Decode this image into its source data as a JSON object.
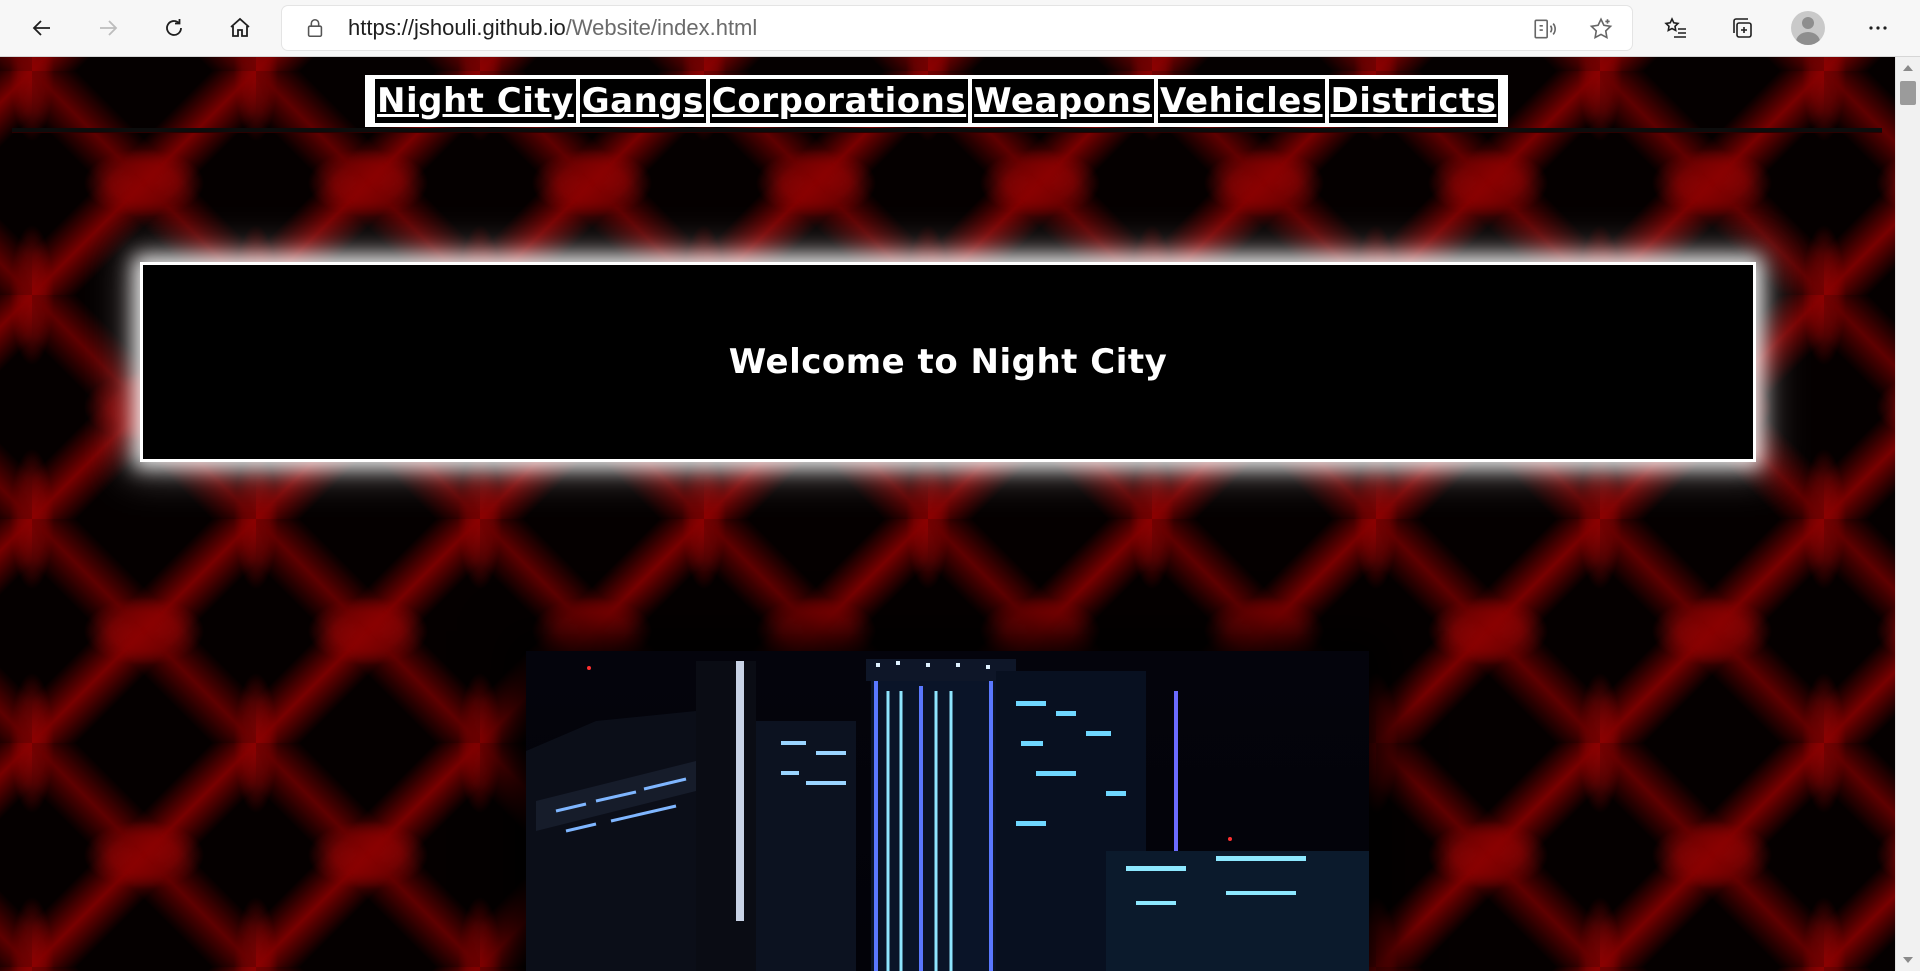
{
  "browser": {
    "url_host": "https://jshouli.github.io",
    "url_path": "/Website/index.html",
    "icons": [
      "back-icon",
      "forward-icon",
      "refresh-icon",
      "home-icon",
      "lock-icon",
      "read-aloud-icon",
      "favorite-star-icon",
      "favorites-list-icon",
      "collections-icon",
      "profile-avatar",
      "more-icon"
    ]
  },
  "page": {
    "nav": [
      {
        "label": "Night City"
      },
      {
        "label": "Gangs"
      },
      {
        "label": "Corporations"
      },
      {
        "label": "Weapons"
      },
      {
        "label": "Vehicles"
      },
      {
        "label": "Districts"
      }
    ],
    "welcome_title": "Welcome to Night City",
    "colors": {
      "background_red": "#8b0000",
      "nav_bg": "#ffffff",
      "nav_item_bg": "#000000",
      "text": "#ffffff"
    }
  }
}
